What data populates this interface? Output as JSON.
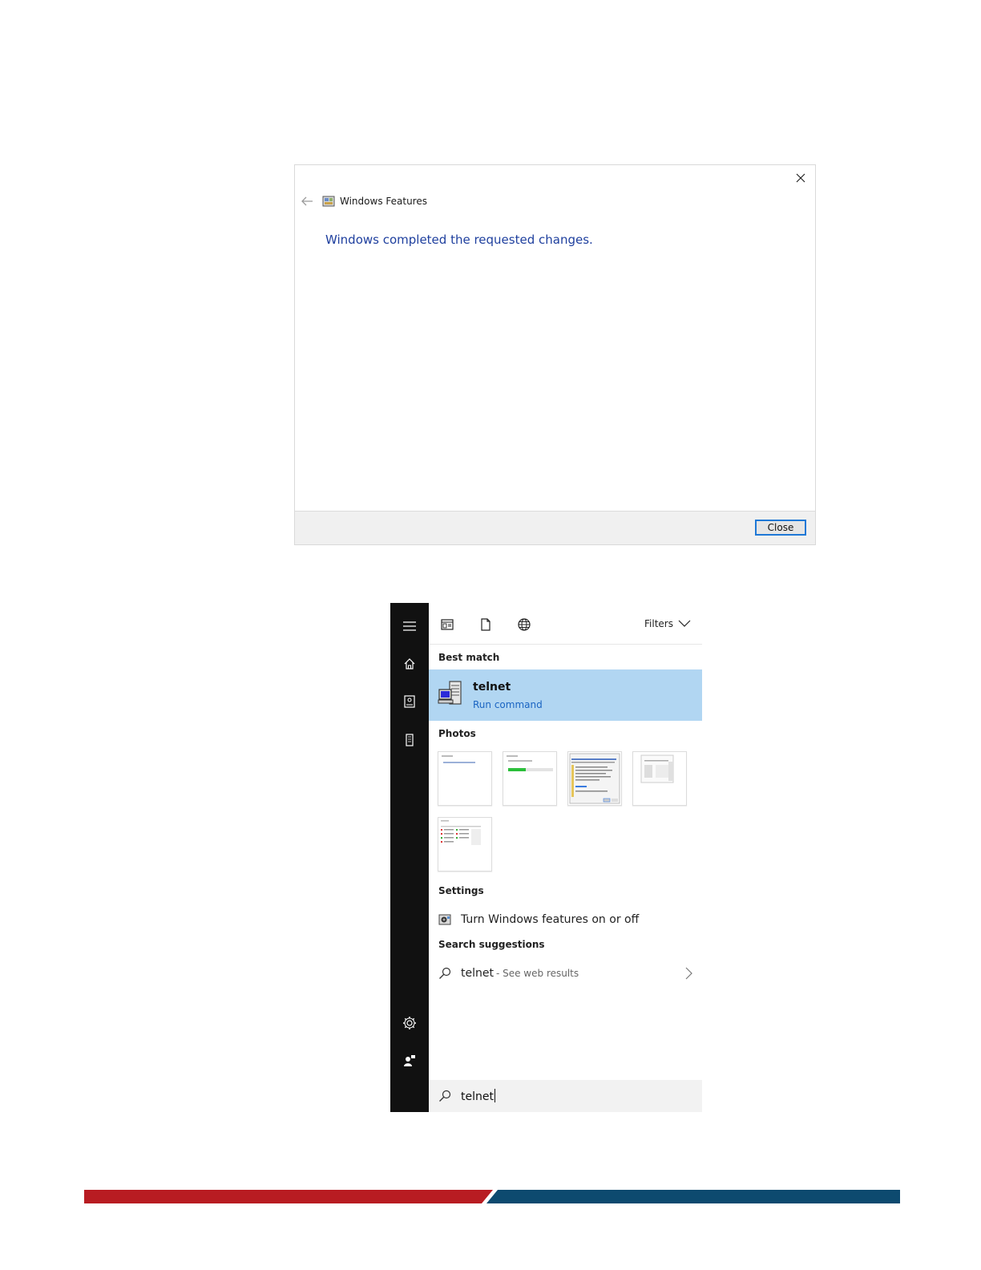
{
  "dialog": {
    "title": "Windows Features",
    "message": "Windows completed the requested changes.",
    "close_button": "Close",
    "icons": {
      "close": "close-icon",
      "back": "back-arrow-icon",
      "app": "windows-features-icon"
    }
  },
  "search": {
    "rail_icons": [
      "hamburger-menu-icon",
      "home-icon",
      "notebook-icon",
      "device-icon",
      "settings-gear-icon",
      "feedback-person-icon"
    ],
    "top_icons": [
      "apps-icon",
      "documents-icon",
      "web-globe-icon"
    ],
    "filters_label": "Filters",
    "best_match": {
      "header": "Best match",
      "name": "telnet",
      "subtitle": "Run command",
      "highlight_color": "#b1d6f2"
    },
    "photos": {
      "header": "Photos",
      "count": 5
    },
    "settings": {
      "header": "Settings",
      "item": "Turn Windows features on or off"
    },
    "suggestions": {
      "header": "Search suggestions",
      "term": "telnet",
      "hint": "- See web results"
    },
    "query": "telnet"
  },
  "colors": {
    "dialog_link_blue": "#1e3f9e",
    "rail_bg": "#111111",
    "stripe_red": "#b81c22",
    "stripe_blue": "#0d4a6f"
  }
}
